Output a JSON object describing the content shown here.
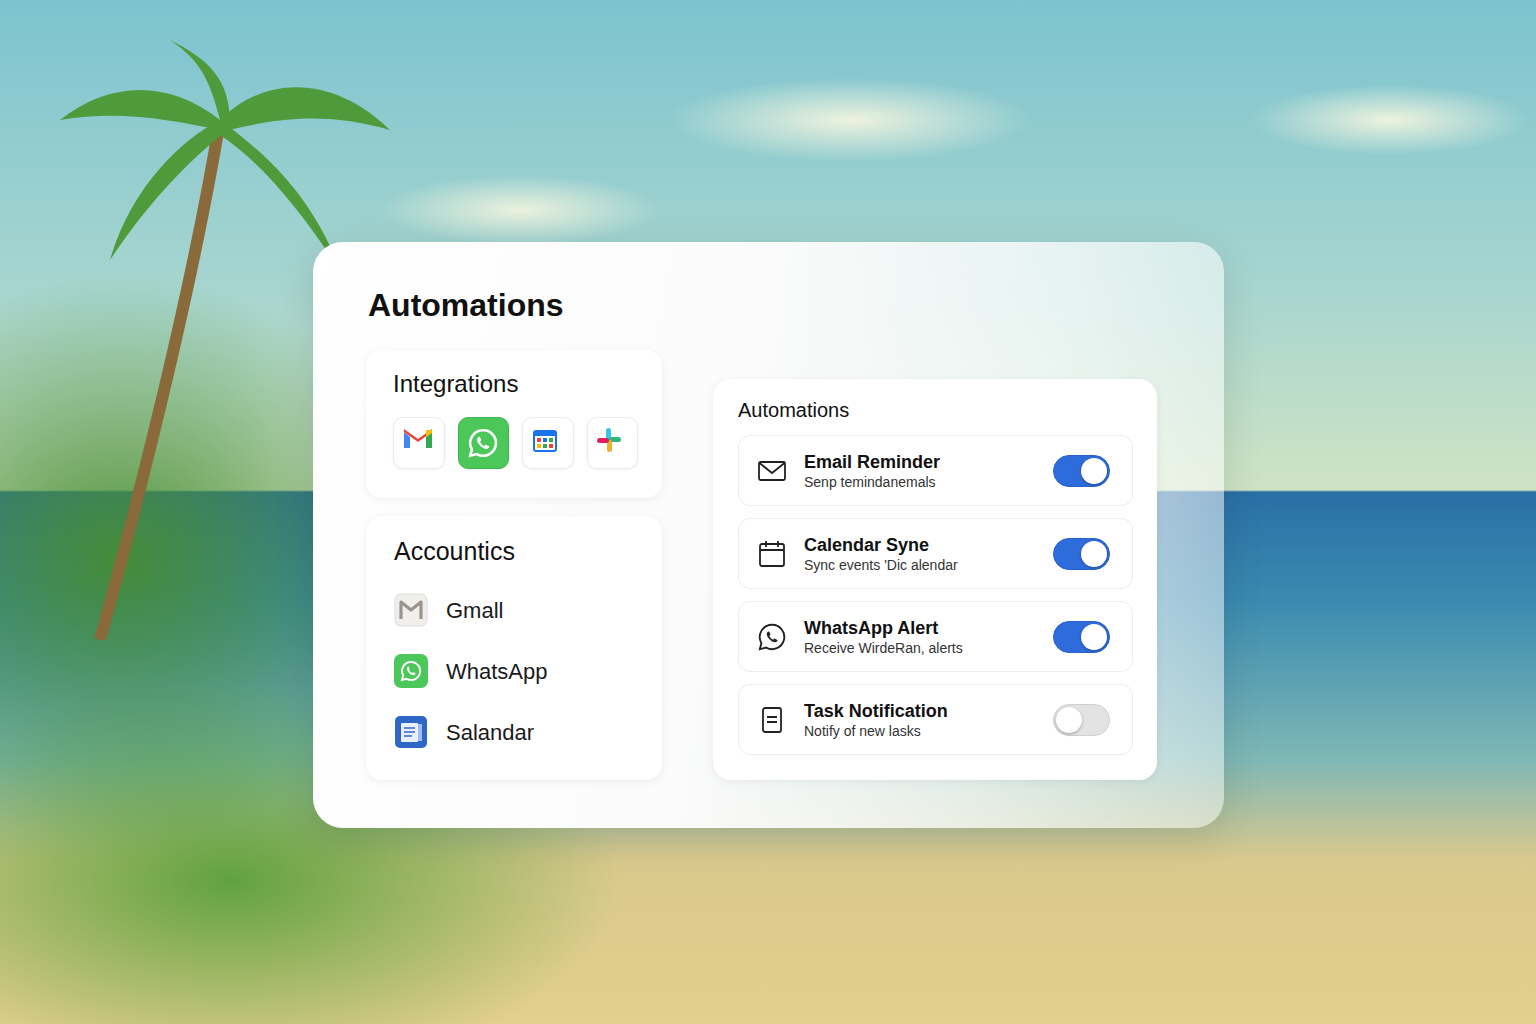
{
  "panel": {
    "title": "Automations"
  },
  "integrations": {
    "title": "Integrations",
    "items": [
      {
        "selected": false
      },
      {
        "selected": true
      },
      {
        "selected": false
      },
      {
        "selected": false
      }
    ]
  },
  "accounts": {
    "title": "Accountics",
    "items": [
      {
        "label": "Gmall"
      },
      {
        "label": "WhatsApp"
      },
      {
        "label": "Salandar"
      }
    ]
  },
  "automations": {
    "title": "Automations",
    "items": [
      {
        "title": "Email Reminder",
        "subtitle": "Senp temindanemals",
        "on": true
      },
      {
        "title": "Calendar Syne",
        "subtitle": "Sync events 'Dic alendar",
        "on": true
      },
      {
        "title": "WhatsApp Alert",
        "subtitle": "Receive WirdeRan, alerts",
        "on": true
      },
      {
        "title": "Task Notification",
        "subtitle": "Notify of new lasks",
        "on": false
      }
    ]
  }
}
